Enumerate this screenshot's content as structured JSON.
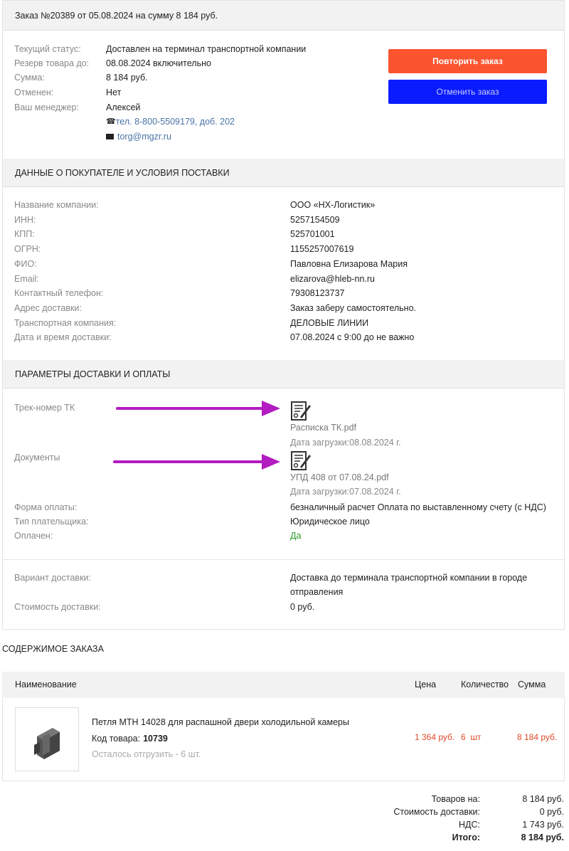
{
  "order": {
    "header": "Заказ №20389 от 05.08.2024 на сумму 8 184 руб.",
    "status_label": "Текущий статус:",
    "status_value": "Доставлен на терминал транспортной компании",
    "reserve_label": "Резерв товара до:",
    "reserve_value": "08.08.2024 включительно",
    "sum_label": "Сумма:",
    "sum_value": "8 184 руб.",
    "cancelled_label": "Отменен:",
    "cancelled_value": "Нет",
    "manager_label": "Ваш менеджер:",
    "manager_value": "Алексей",
    "manager_phone": "тел. 8-800-5509179, доб. 202",
    "manager_email": "torg@mgzr.ru",
    "repeat_button": "Повторить заказ",
    "cancel_button": "Отменить заказ"
  },
  "buyer": {
    "section_title": "ДАННЫЕ О ПОКУПАТЕЛЕ И УСЛОВИЯ ПОСТАВКИ",
    "rows": [
      {
        "label": "Название компании:",
        "value": "ООО «НХ-Логистик»"
      },
      {
        "label": "ИНН:",
        "value": "5257154509"
      },
      {
        "label": "КПП:",
        "value": "525701001"
      },
      {
        "label": "ОГРН:",
        "value": "1155257007619"
      },
      {
        "label": "ФИО:",
        "value": "Павловна Елизарова Мария"
      },
      {
        "label": "Email:",
        "value": "elizarova@hleb-nn.ru"
      },
      {
        "label": "Контактный телефон:",
        "value": "79308123737"
      },
      {
        "label": "Адрес доставки:",
        "value": "Заказ заберу самостоятельно."
      },
      {
        "label": "Транспортная компания:",
        "value": "ДЕЛОВЫЕ ЛИНИИ"
      },
      {
        "label": "Дата и время доставки:",
        "value": "07.08.2024 с 9:00 до не важно"
      }
    ]
  },
  "delivery": {
    "section_title": "ПАРАМЕТРЫ ДОСТАВКИ И ОПЛАТЫ",
    "track_label": "Трек-номер ТК",
    "track_file": "Расписка ТК.pdf",
    "track_date": "Дата загрузки:08.08.2024 г.",
    "docs_label": "Документы",
    "docs_file": "УПД 408 от 07.08.24.pdf",
    "docs_date": "Дата загрузки:07.08.2024 г.",
    "payment_form_label": "Форма оплаты:",
    "payment_form_value": "безналичный расчет Оплата по выставленному счету (с НДС)",
    "payer_type_label": "Тип плательщика:",
    "payer_type_value": "Юридическое лицо",
    "paid_label": "Оплачен:",
    "paid_value": "Да",
    "variant_label": "Вариант доставки:",
    "variant_value_1": "Доставка до терминала транспортной компании в городе",
    "variant_value_2": "отправления",
    "cost_label": "Стоимость доставки:",
    "cost_value": "0 руб."
  },
  "contents": {
    "title": "СОДЕРЖИМОЕ ЗАКАЗА",
    "col_name": "Наименование",
    "col_price": "Цена",
    "col_qty": "Количество",
    "col_sum": "Сумма",
    "item": {
      "name": "Петля МТН 14028 для распашной двери холодильной камеры",
      "code_label": "Код товара:",
      "code_value": "10739",
      "remaining": "Осталось отгрузить - 6 шт.",
      "price": "1 364 руб.",
      "qty": "6  шт",
      "sum": "8 184 руб."
    }
  },
  "totals": {
    "goods_label": "Товаров на:",
    "goods_value": "8 184 руб.",
    "delivery_label": "Стоимость доставки:",
    "delivery_value": "0 руб.",
    "vat_label": "НДС:",
    "vat_value": "1 743 руб.",
    "total_label": "Итого:",
    "total_value": "8 184 руб."
  },
  "colors": {
    "accent_orange": "#fb5530",
    "accent_blue": "#0a1cff",
    "link": "#4a73a8",
    "arrow": "#b21cc0"
  }
}
